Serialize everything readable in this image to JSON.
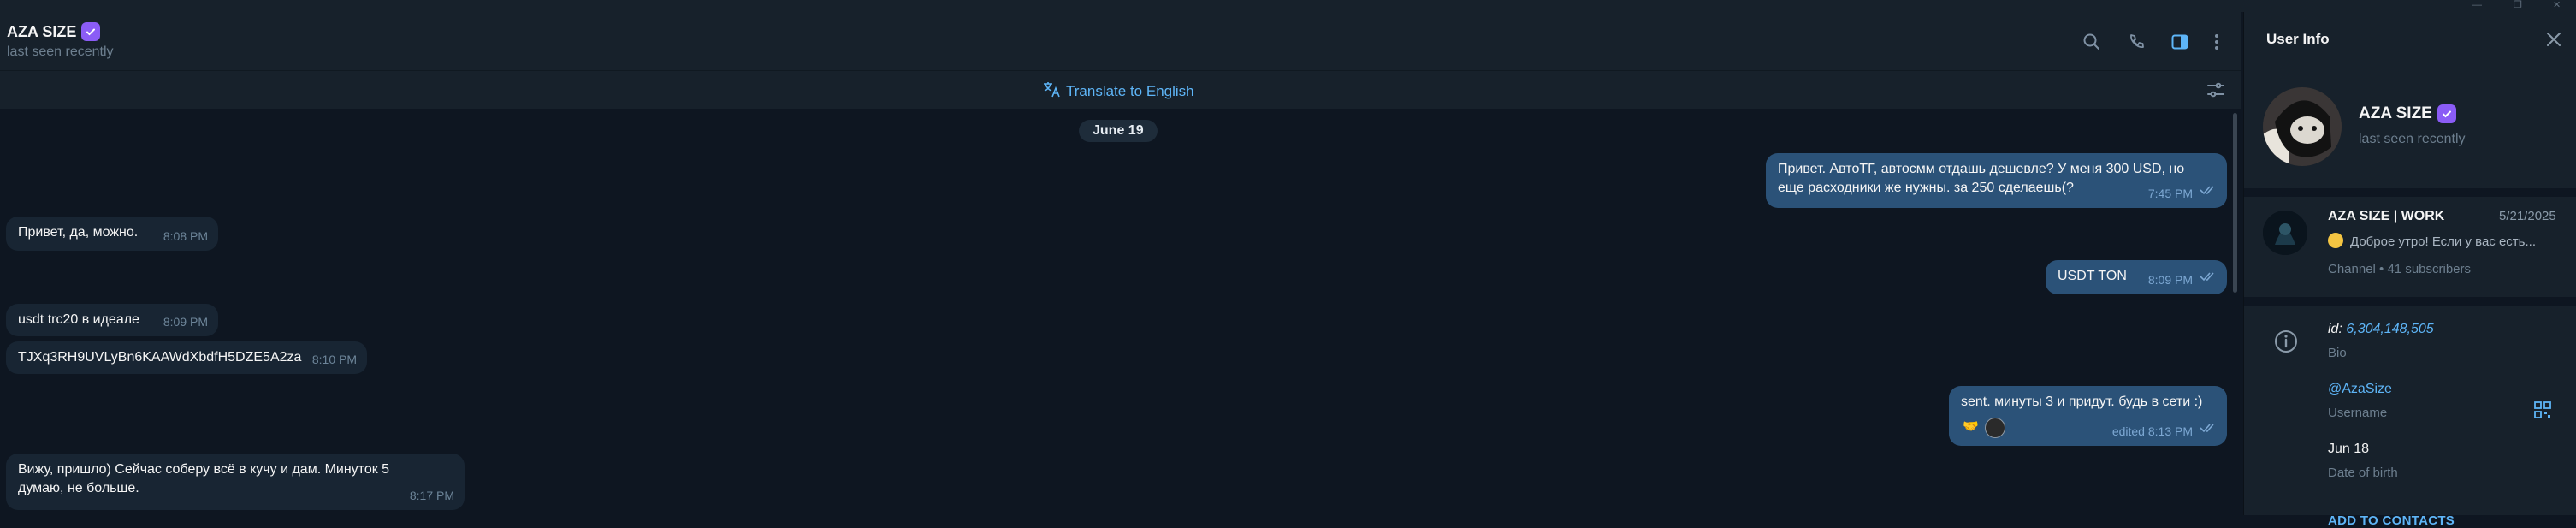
{
  "header": {
    "name": "AZA SIZE",
    "status": "last seen recently"
  },
  "translate": {
    "label": "Translate to English"
  },
  "date_separator": "June 19",
  "messages": [
    {
      "dir": "out",
      "text": "Привет. АвтоТГ, автосмм отдашь дешевле? У меня 300 USD, но еще расходники же нужны. за 250 сделаешь(?",
      "time": "7:45 PM"
    },
    {
      "dir": "in",
      "text": "Привет, да, можно.",
      "time": "8:08 PM"
    },
    {
      "dir": "out",
      "text": "USDT TON",
      "time": "8:09 PM"
    },
    {
      "dir": "in",
      "text": "usdt trc20 в идеале",
      "time": "8:09 PM"
    },
    {
      "dir": "in",
      "text": "TJXq3RH9UVLyBn6KAAWdXbdfH5DZE5A2za",
      "time": "8:10 PM"
    },
    {
      "dir": "out",
      "text": "sent. минуты 3 и придут. будь в сети :)",
      "time": "edited 8:13 PM"
    },
    {
      "dir": "in",
      "text": "Вижу, пришло) Сейчас соберу всё в кучу и дам. Минуток 5 думаю, не больше.",
      "time": "8:17 PM"
    }
  ],
  "sidebar": {
    "title": "User Info",
    "name": "AZA SIZE",
    "status": "last seen recently",
    "channel": {
      "name": "AZA SIZE | WORK",
      "date": "5/21/2025",
      "preview": "Доброе утро!  Если у вас есть...",
      "meta": "Channel • 41 subscribers"
    },
    "id_prefix": "id: ",
    "id_value": "6,304,148,505",
    "bio_label": "Bio",
    "username": "@AzaSize",
    "username_label": "Username",
    "birth": "Jun 18",
    "birth_label": "Date of birth",
    "add_contacts": "ADD TO CONTACTS"
  },
  "colors": {
    "bg": "#0e1621",
    "panel": "#17212b",
    "incoming": "#182533",
    "outgoing": "#2b5278",
    "accent": "#5eb5f7",
    "verified": "#8b5cf6"
  },
  "icons": [
    "search-icon",
    "phone-icon",
    "sidebar-toggle-icon",
    "more-icon",
    "translate-icon",
    "filter-icon",
    "close-icon",
    "info-icon",
    "qr-icon",
    "double-check-icon",
    "verified-icon"
  ]
}
